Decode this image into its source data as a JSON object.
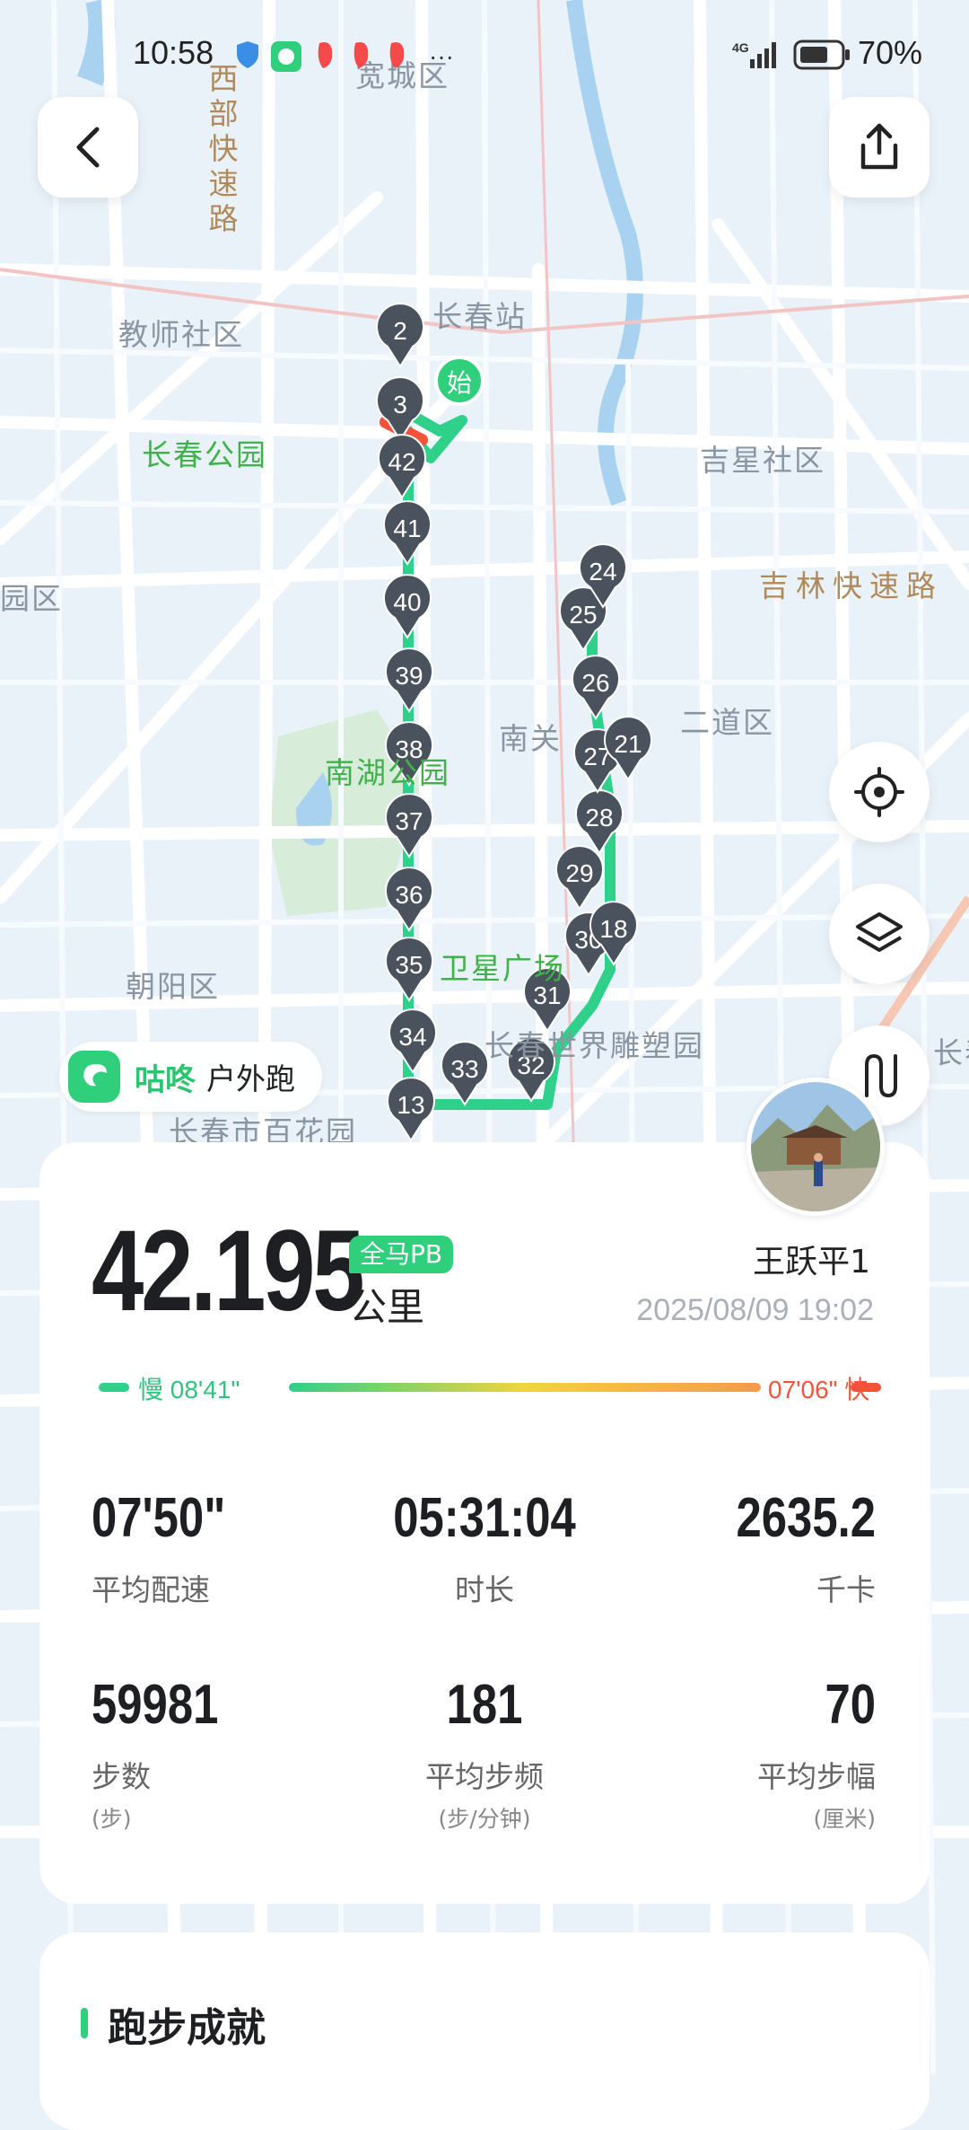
{
  "status_bar": {
    "time": "10:58",
    "network": "4G",
    "battery": "70%"
  },
  "map": {
    "labels": {
      "district_kuancheng": "宽城区",
      "road_west": "西部快速路",
      "station": "长春站",
      "teacher_community": "教师社区",
      "changchun_park": "长春公园",
      "jixing_community": "吉星社区",
      "jilin_expressway": "吉林快速路",
      "district_lu": "园区",
      "district_erdao": "二道区",
      "nanguan": "南关",
      "nanhu_park": "南湖公园",
      "weixing_square": "卫星广场",
      "sculpture_park": "长春世界雕塑园",
      "district_chaoyang": "朝阳区",
      "baihua": "长春市百花园",
      "changchun_right": "长春"
    },
    "start_marker": "始",
    "km_markers": [
      "2",
      "3",
      "42",
      "41",
      "40",
      "39",
      "38",
      "37",
      "36",
      "35",
      "34",
      "13",
      "33",
      "32",
      "31",
      "30",
      "29",
      "28",
      "27",
      "26",
      "25",
      "24",
      "21",
      "18"
    ]
  },
  "brand": {
    "name": "咕咚",
    "mode": "户外跑"
  },
  "colors": {
    "accent": "#2fcf7c",
    "pace_slow": "#2fd08a",
    "pace_fast": "#f4533a",
    "route_pins": "#4a525d"
  },
  "summary": {
    "distance": "42.195",
    "badge": "全马PB",
    "unit": "公里",
    "username": "王跃平1",
    "datetime": "2025/08/09 19:02",
    "pace_slow_label": "慢 08'41\"",
    "pace_fast_label": "07'06\" 快"
  },
  "stats": [
    {
      "value": "07'50\"",
      "label": "平均配速",
      "sub": ""
    },
    {
      "value": "05:31:04",
      "label": "时长",
      "sub": ""
    },
    {
      "value": "2635.2",
      "label": "千卡",
      "sub": ""
    },
    {
      "value": "59981",
      "label": "步数",
      "sub": "(步)"
    },
    {
      "value": "181",
      "label": "平均步频",
      "sub": "(步/分钟)"
    },
    {
      "value": "70",
      "label": "平均步幅",
      "sub": "(厘米)"
    }
  ],
  "achievements": {
    "title": "跑步成就"
  }
}
